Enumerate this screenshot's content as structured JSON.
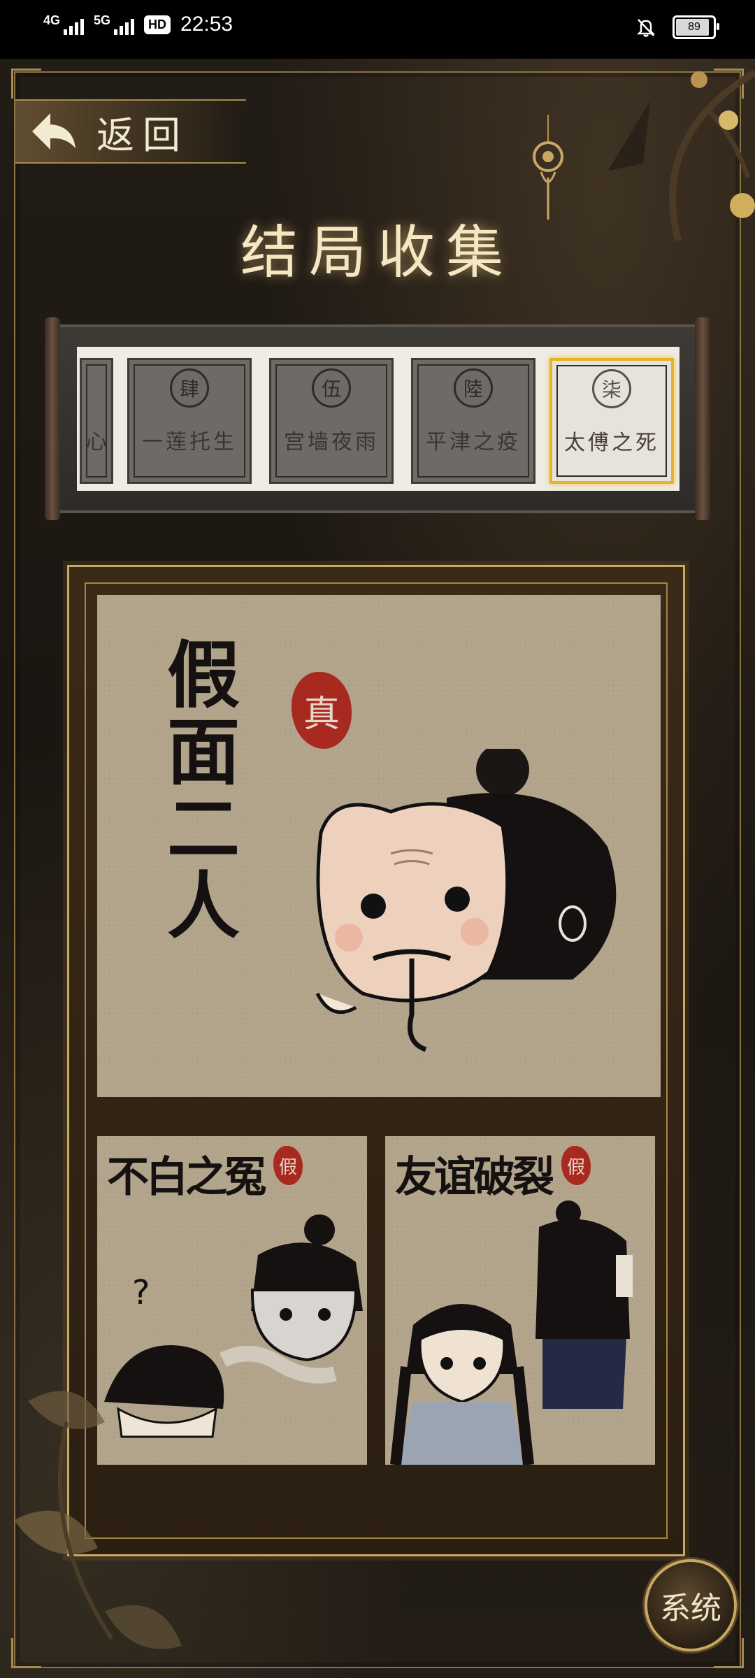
{
  "status_bar": {
    "signal_1_label": "4G",
    "signal_2_label": "5G",
    "hd_label": "HD",
    "time": "22:53",
    "battery": "89"
  },
  "header": {
    "back_label": "返回",
    "title": "结局收集"
  },
  "endings": {
    "cards": [
      {
        "seal": "",
        "name": "心",
        "partial": true
      },
      {
        "seal": "肆",
        "name": "一莲托生"
      },
      {
        "seal": "伍",
        "name": "宫墙夜雨"
      },
      {
        "seal": "陸",
        "name": "平津之疫"
      },
      {
        "seal": "柒",
        "name": "太傅之死",
        "selected": true
      }
    ]
  },
  "gallery": {
    "main": {
      "title": "假面二人",
      "stamp": "真"
    },
    "sub": [
      {
        "title": "不白之冤",
        "stamp": "假"
      },
      {
        "title": "友谊破裂",
        "stamp": "假"
      }
    ]
  },
  "system_button": "系统",
  "colors": {
    "accent_gold": "#c9a866",
    "selected_border": "#e8b324",
    "stamp_red": "#a8291f"
  }
}
